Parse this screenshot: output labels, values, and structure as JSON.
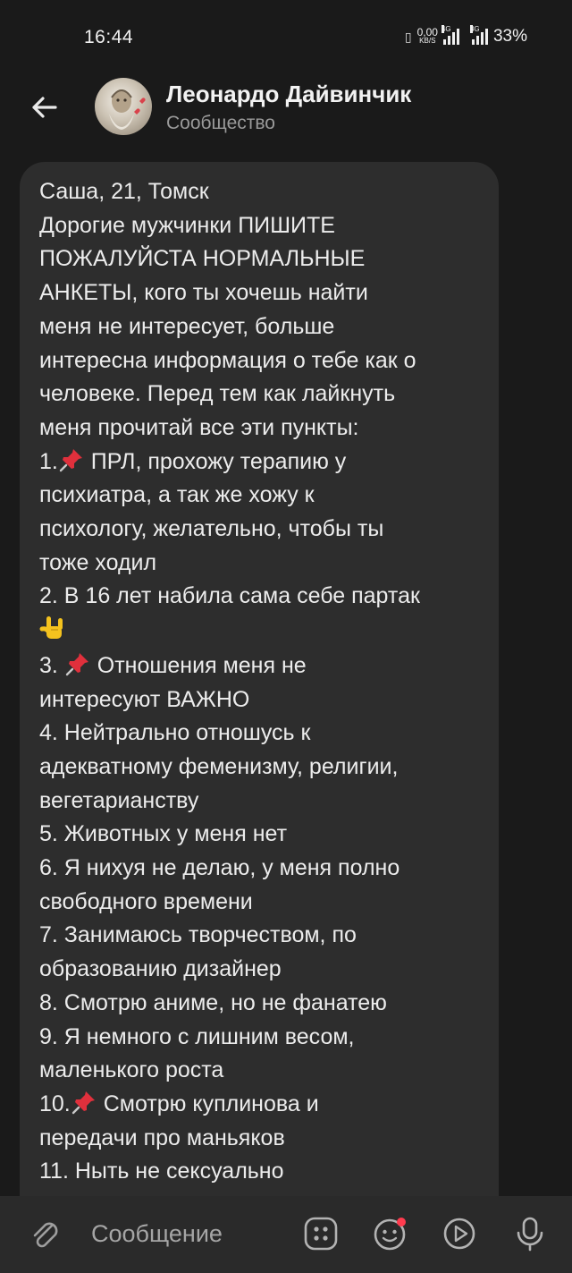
{
  "status_bar": {
    "time": "16:44",
    "net_speed_value": "0,00",
    "net_speed_unit": "KB/S",
    "network_1": "4G",
    "network_2": "3G",
    "battery": "33%"
  },
  "header": {
    "title": "Леонардо Дайвинчик",
    "subtitle": "Сообщество"
  },
  "message": {
    "lines": [
      "Саша, 21, Томск",
      "Дорогие мужчинки ПИШИТЕ",
      "ПОЖАЛУЙСТА НОРМАЛЬНЫЕ",
      "АНКЕТЫ, кого ты хочешь найти",
      "меня не интересует, больше",
      "интересна информация о тебе как о",
      "человеке. Перед тем как лайкнуть",
      "меня прочитай все эти пункты:",
      {
        "before": "1.",
        "icon": "pushpin",
        "after": " ПРЛ, прохожу терапию у"
      },
      "психиатра, а так же хожу к",
      "психологу, желательно, чтобы ты",
      "тоже ходил",
      "2. В 16 лет набила сама себе партак",
      {
        "before": "",
        "icon": "sign-of-the-horns",
        "after": ""
      },
      {
        "before": "3. ",
        "icon": "pushpin",
        "after": " Отношения меня не"
      },
      "интересуют ВАЖНО",
      "4. Нейтрально отношусь к",
      "адекватному феменизму, религии,",
      "вегетарианству",
      "5. Животных у меня нет",
      "6. Я нихуя не делаю, у меня полно",
      "свободного времени",
      "7. Занимаюсь творчеством, по",
      "образованию дизайнер",
      "8. Смотрю аниме, но не фанатею",
      "9. Я немного с лишним весом,",
      "маленького роста",
      {
        "before": "10.",
        "icon": "pushpin",
        "after": " Смотрю куплинова и"
      },
      "передачи про маньяков",
      "11. Ныть не сексуально"
    ]
  },
  "composer": {
    "placeholder": "Сообщение"
  },
  "colors": {
    "background": "#1a1a1a",
    "bubble": "#2d2d2d",
    "composer": "#2a2a2a",
    "notification_dot": "#ff3b4e"
  }
}
